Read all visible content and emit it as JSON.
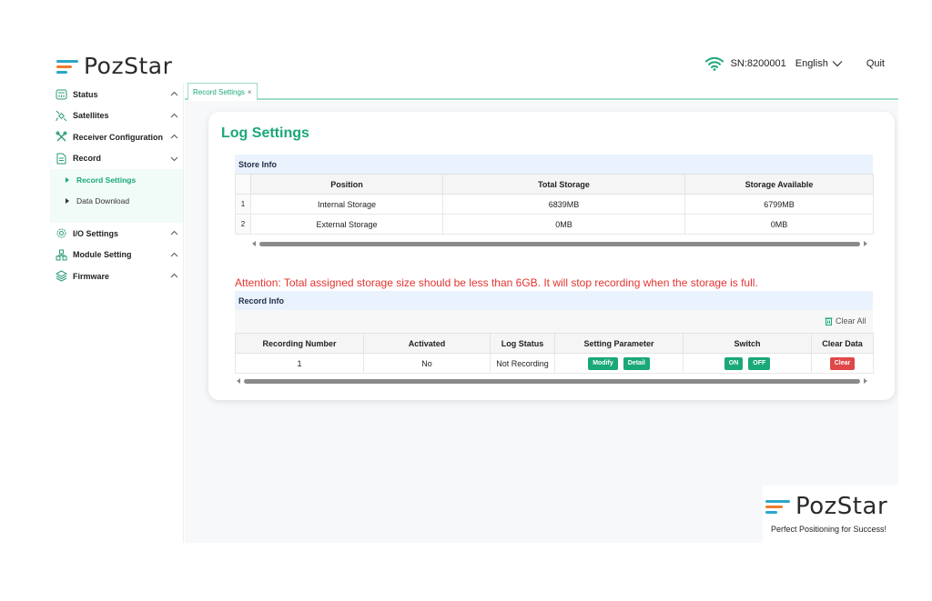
{
  "header": {
    "logo_text": "PozStar",
    "sn": "SN:8200001",
    "language": "English",
    "quit": "Quit"
  },
  "sidebar": {
    "items": [
      {
        "label": "Status",
        "icon": "status-icon"
      },
      {
        "label": "Satellites",
        "icon": "satellite-icon"
      },
      {
        "label": "Receiver Configuration",
        "icon": "tools-icon"
      },
      {
        "label": "Record",
        "icon": "record-icon"
      },
      {
        "label": "I/O Settings",
        "icon": "gear-icon"
      },
      {
        "label": "Module Setting",
        "icon": "module-icon"
      },
      {
        "label": "Firmware",
        "icon": "layers-icon"
      }
    ],
    "record_sub": [
      {
        "label": "Record Settings",
        "active": true
      },
      {
        "label": "Data Download",
        "active": false
      }
    ]
  },
  "tabs": [
    {
      "label": "Record Settings",
      "close": "×"
    }
  ],
  "page": {
    "title": "Log Settings",
    "store_info": {
      "heading": "Store Info",
      "columns": [
        "Position",
        "Total Storage",
        "Storage Available"
      ],
      "rows": [
        {
          "index": "1",
          "position": "Internal Storage",
          "total": "6839MB",
          "available": "6799MB"
        },
        {
          "index": "2",
          "position": "External Storage",
          "total": "0MB",
          "available": "0MB"
        }
      ]
    },
    "attention": "Attention: Total assigned storage size should be less than 6GB. It will stop recording when the storage is full.",
    "record_info": {
      "heading": "Record Info",
      "clear_all": "Clear All",
      "columns": [
        "Recording Number",
        "Activated",
        "Log Status",
        "Setting Parameter",
        "Switch",
        "Clear Data"
      ],
      "rows": [
        {
          "number": "1",
          "activated": "No",
          "status": "Not Recording",
          "modify": "Modify",
          "detail": "Detail",
          "on": "ON",
          "off": "OFF",
          "clear": "Clear"
        }
      ]
    }
  },
  "brand": {
    "logo_text": "PozStar",
    "tagline": "Perfect Positioning for Success!"
  },
  "colors": {
    "accent": "#1aa879",
    "attention": "#e3342f",
    "section_header": "#e9f2fd",
    "logo_blue": "#2aa6c9",
    "logo_orange": "#f07a2c",
    "danger": "#e04848"
  }
}
